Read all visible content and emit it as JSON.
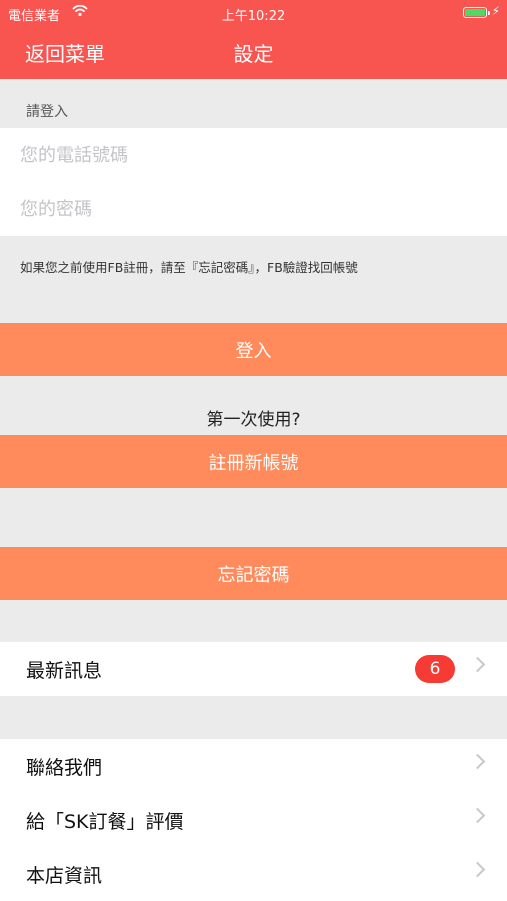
{
  "status_bar": {
    "carrier": "電信業者",
    "time": "上午10:22",
    "battery_level": 1.0
  },
  "nav": {
    "back_label": "返回菜單",
    "title": "設定"
  },
  "login": {
    "section_label": "請登入",
    "phone_placeholder": "您的電話號碼",
    "password_placeholder": "您的密碼",
    "hint": "如果您之前使用FB註冊，請至『忘記密碼』，FB驗證找回帳號",
    "login_button": "登入",
    "first_time_text": "第一次使用?",
    "register_button": "註冊新帳號",
    "forgot_button": "忘記密碼"
  },
  "menu": {
    "news": {
      "label": "最新訊息",
      "badge": "6"
    },
    "items": [
      {
        "label": "聯絡我們"
      },
      {
        "label": "給「SK訂餐」評價"
      },
      {
        "label": "本店資訊"
      }
    ]
  },
  "colors": {
    "header": "#f85450",
    "button": "#ff8a5b",
    "badge": "#f63b35",
    "background": "#ebebeb"
  }
}
